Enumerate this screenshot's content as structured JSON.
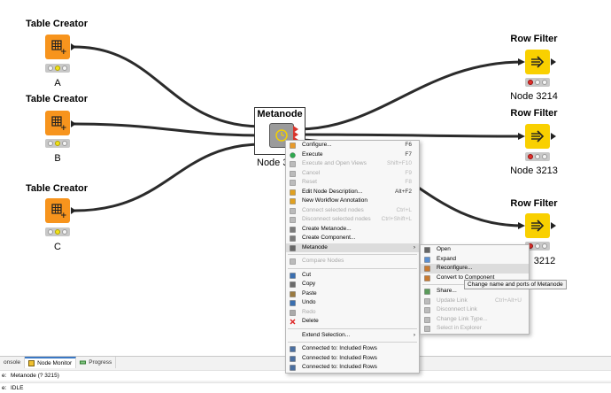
{
  "workflow": {
    "table_creators": [
      {
        "title": "Table Creator",
        "label": "A"
      },
      {
        "title": "Table Creator",
        "label": "B"
      },
      {
        "title": "Table Creator",
        "label": "C"
      }
    ],
    "metanode": {
      "title": "Metanode",
      "label": "Node 3"
    },
    "row_filters": [
      {
        "title": "Row Filter",
        "label": "Node 3214"
      },
      {
        "title": "Row Filter",
        "label": "Node 3213"
      },
      {
        "title": "Row Filter",
        "label": "3212"
      }
    ],
    "colors": {
      "table_creator": "#f7941d",
      "row_filter": "#f9d000",
      "metanode": "#9b9b9b",
      "port_selected": "#d9342b"
    }
  },
  "context_menu": {
    "items": [
      {
        "label": "Configure...",
        "shortcut": "F6",
        "icon": "configure-icon"
      },
      {
        "label": "Execute",
        "shortcut": "F7",
        "icon": "execute-icon"
      },
      {
        "label": "Execute and Open Views",
        "shortcut": "Shift+F10",
        "icon": "execute-open-views-icon",
        "disabled": true
      },
      {
        "label": "Cancel",
        "shortcut": "F9",
        "icon": "cancel-icon",
        "disabled": true
      },
      {
        "label": "Reset",
        "shortcut": "F8",
        "icon": "reset-icon",
        "disabled": true
      },
      {
        "label": "Edit Node Description...",
        "shortcut": "Alt+F2",
        "icon": "edit-description-icon"
      },
      {
        "label": "New Workflow Annotation",
        "shortcut": "",
        "icon": "annotation-icon"
      },
      {
        "label": "Connect selected nodes",
        "shortcut": "Ctrl+L",
        "icon": "connect-icon",
        "disabled": true
      },
      {
        "label": "Disconnect selected nodes",
        "shortcut": "Ctrl+Shift+L",
        "icon": "disconnect-icon",
        "disabled": true
      },
      {
        "label": "Create Metanode...",
        "shortcut": "",
        "icon": "create-metanode-icon"
      },
      {
        "label": "Create Component...",
        "shortcut": "",
        "icon": "create-component-icon"
      },
      {
        "label": "Metanode",
        "shortcut": "",
        "icon": "metanode-icon",
        "submenu": true,
        "hover": true
      },
      {
        "separator": true
      },
      {
        "label": "Compare Nodes",
        "shortcut": "",
        "icon": "compare-icon",
        "disabled": true
      },
      {
        "separator": true
      },
      {
        "label": "Cut",
        "shortcut": "",
        "icon": "cut-icon"
      },
      {
        "label": "Copy",
        "shortcut": "",
        "icon": "copy-icon"
      },
      {
        "label": "Paste",
        "shortcut": "",
        "icon": "paste-icon"
      },
      {
        "label": "Undo",
        "shortcut": "",
        "icon": "undo-icon"
      },
      {
        "label": "Redo",
        "shortcut": "",
        "icon": "redo-icon",
        "disabled": true
      },
      {
        "label": "Delete",
        "shortcut": "",
        "icon": "delete-icon"
      },
      {
        "separator": true
      },
      {
        "label": "Extend Selection...",
        "shortcut": "",
        "icon": "",
        "submenu": true
      },
      {
        "separator": true
      },
      {
        "label": "Connected to: Included Rows",
        "shortcut": "",
        "icon": "table-view-icon"
      },
      {
        "label": "Connected to: Included Rows",
        "shortcut": "",
        "icon": "table-view-icon"
      },
      {
        "label": "Connected to: Included Rows",
        "shortcut": "",
        "icon": "table-view-icon"
      }
    ]
  },
  "submenu": {
    "items": [
      {
        "label": "Open",
        "shortcut": "",
        "icon": "open-icon"
      },
      {
        "label": "Expand",
        "shortcut": "",
        "icon": "expand-icon"
      },
      {
        "label": "Reconfigure...",
        "shortcut": "",
        "icon": "reconfigure-icon",
        "hover": true
      },
      {
        "label": "Convert to Component",
        "shortcut": "",
        "icon": "convert-icon"
      },
      {
        "separator": true
      },
      {
        "label": "Share...",
        "shortcut": "",
        "icon": "share-icon"
      },
      {
        "label": "Update Link",
        "shortcut": "Ctrl+Alt+U",
        "icon": "update-link-icon",
        "disabled": true
      },
      {
        "label": "Disconnect Link",
        "shortcut": "",
        "icon": "disconnect-link-icon",
        "disabled": true
      },
      {
        "label": "Change Link Type...",
        "shortcut": "",
        "icon": "change-link-icon",
        "disabled": true
      },
      {
        "label": "Select in Explorer",
        "shortcut": "",
        "icon": "select-explorer-icon",
        "disabled": true
      }
    ],
    "tooltip": "Change name and ports of Metanode"
  },
  "bottom_panel": {
    "tabs": [
      {
        "label": "onsole",
        "icon": "console-icon"
      },
      {
        "label": "Node Monitor",
        "icon": "node-monitor-icon",
        "active": true
      },
      {
        "label": "Progress",
        "icon": "progress-icon"
      }
    ],
    "node_row": {
      "label": "e:",
      "value": "Metanode  (? 3215)"
    },
    "state_row": {
      "label": "e:",
      "value": "IDLE"
    }
  }
}
